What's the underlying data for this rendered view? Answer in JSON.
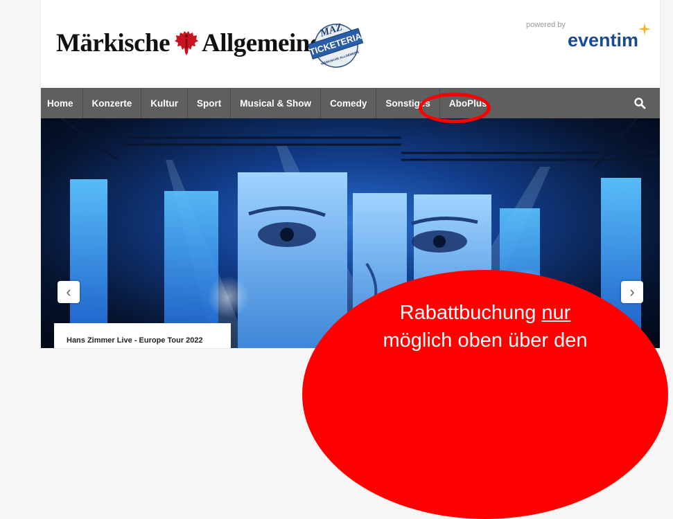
{
  "header": {
    "brand_part1": "Märkische",
    "brand_part2": "Allgemeine",
    "maz_badge_top": "MAZ",
    "maz_badge_main": "TICKETERIA",
    "maz_badge_bottom": "MÄRKISCHE ALLGEMEINE",
    "powered_by": "powered by",
    "partner": "eventim"
  },
  "nav": {
    "items": [
      "Home",
      "Konzerte",
      "Kultur",
      "Sport",
      "Musical & Show",
      "Comedy",
      "Sonstiges",
      "AboPlus"
    ],
    "search_icon": "search-icon"
  },
  "hero": {
    "prev_arrow": "‹",
    "next_arrow": "›",
    "caption": "Hans Zimmer Live - Europe Tour 2022"
  },
  "annotation": {
    "line1_prefix": "Rabattbuchung ",
    "line1_emphasis": "nur",
    "line2": "möglich oben über den"
  },
  "colors": {
    "nav_background": "#5f5f5f",
    "brand_blue": "#1a4a93",
    "annotation_red": "#ff0000"
  }
}
